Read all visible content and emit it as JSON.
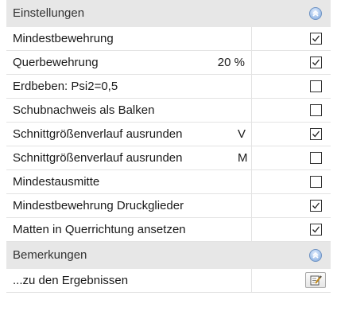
{
  "sections": {
    "settings": {
      "title": "Einstellungen",
      "icon": "collapse-up-icon",
      "rows": [
        {
          "label": "Mindestbewehrung",
          "checked": true
        },
        {
          "label": "Querbewehrung",
          "value": "20 %",
          "checked": true
        },
        {
          "label": "Erdbeben: Psi2=0,5",
          "checked": false
        },
        {
          "label": "Schubnachweis als Balken",
          "checked": false
        },
        {
          "label": "Schnittgrößenverlauf ausrunden",
          "suffix": "V",
          "checked": true
        },
        {
          "label": "Schnittgrößenverlauf ausrunden",
          "suffix": "M",
          "checked": false
        },
        {
          "label": "Mindestausmitte",
          "checked": false
        },
        {
          "label": "Mindestbewehrung Druckglieder",
          "checked": true
        },
        {
          "label": "Matten in Querrichtung ansetzen",
          "checked": true
        }
      ]
    },
    "remarks": {
      "title": "Bemerkungen",
      "icon": "collapse-up-icon",
      "rows": [
        {
          "label": "...zu den Ergebnissen",
          "button_icon": "edit-note-icon"
        }
      ]
    }
  },
  "colors": {
    "header_bg": "#e7e7e7",
    "row_border": "#e3e3e3",
    "collapse_accent": "#7ea6da"
  }
}
